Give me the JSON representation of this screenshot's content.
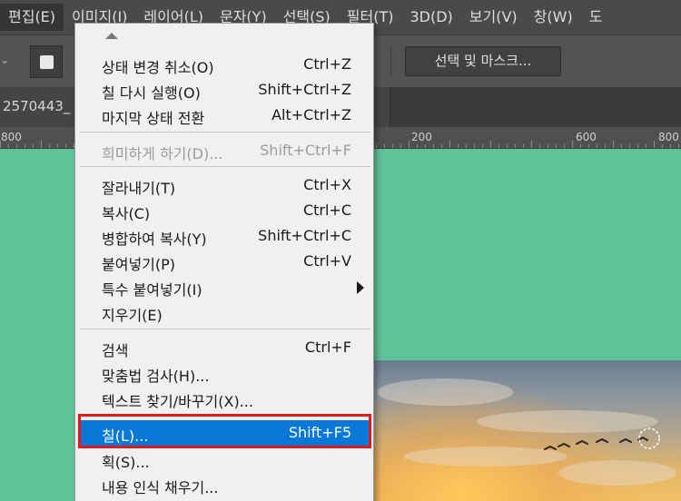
{
  "menubar": {
    "items": [
      {
        "label": "편집(E)",
        "active": true
      },
      {
        "label": "이미지(I)"
      },
      {
        "label": "레이어(L)"
      },
      {
        "label": "문자(Y)"
      },
      {
        "label": "선택(S)"
      },
      {
        "label": "필터(T)"
      },
      {
        "label": "3D(D)"
      },
      {
        "label": "보기(V)"
      },
      {
        "label": "창(W)"
      },
      {
        "label": "도"
      }
    ]
  },
  "options_bar": {
    "select_mask_label": "선택 및 마스크..."
  },
  "document": {
    "tab_label": "2570443_"
  },
  "ruler": {
    "labels": [
      "800",
      "200",
      "600",
      "800"
    ]
  },
  "edit_menu": {
    "items": [
      {
        "label": "상태 변경 취소(O)",
        "shortcut": "Ctrl+Z"
      },
      {
        "label": "칠 다시 실행(O)",
        "shortcut": "Shift+Ctrl+Z"
      },
      {
        "label": "마지막 상태 전환",
        "shortcut": "Alt+Ctrl+Z"
      },
      {
        "label": "희미하게 하기(D)...",
        "shortcut": "Shift+Ctrl+F",
        "disabled": true
      },
      {
        "label": "잘라내기(T)",
        "shortcut": "Ctrl+X"
      },
      {
        "label": "복사(C)",
        "shortcut": "Ctrl+C"
      },
      {
        "label": "병합하여 복사(Y)",
        "shortcut": "Shift+Ctrl+C"
      },
      {
        "label": "붙여넣기(P)",
        "shortcut": "Ctrl+V"
      },
      {
        "label": "특수 붙여넣기(I)",
        "shortcut": ""
      },
      {
        "label": "지우기(E)",
        "shortcut": ""
      },
      {
        "label": "검색",
        "shortcut": "Ctrl+F"
      },
      {
        "label": "맞춤법 검사(H)...",
        "shortcut": ""
      },
      {
        "label": "텍스트 찾기/바꾸기(X)...",
        "shortcut": ""
      },
      {
        "label": "칠(L)...",
        "shortcut": "Shift+F5",
        "highlighted": true
      },
      {
        "label": "획(S)...",
        "shortcut": ""
      },
      {
        "label": "내용 인식 채우기...",
        "shortcut": ""
      }
    ]
  },
  "colors": {
    "canvas_background": "#5fc399",
    "menu_highlight": "#0a78d7",
    "annotation_box": "#e01919"
  },
  "icons": {
    "submenu": "chevron-right-icon",
    "scroll_up": "caret-up-icon",
    "swatch": "square-swatch-icon"
  }
}
